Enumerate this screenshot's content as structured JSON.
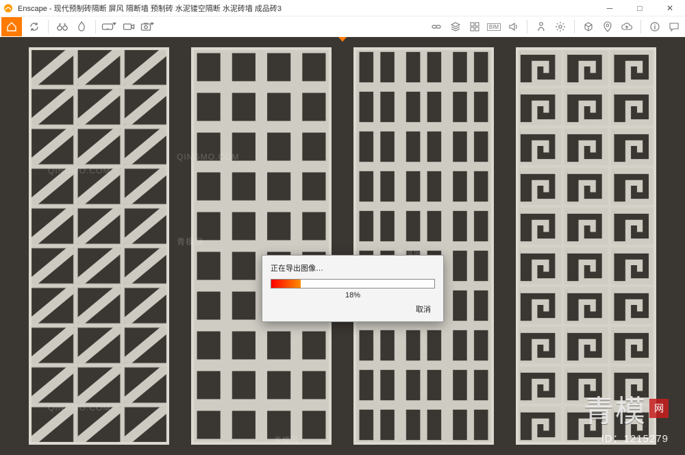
{
  "app_icon": "enscape-icon",
  "title": "Enscape - 现代预制砖隔断 屏风 隔断墙 预制砖 水泥镂空隔断 水泥砖墙 成品砖3",
  "bim_label": "BIM",
  "marker_caret": "▼",
  "dialog": {
    "title": "正在导出图像…",
    "percent_label": "18%",
    "percent_value": 18,
    "cancel": "取消"
  },
  "watermarks": {
    "small_1": "QINGMO.COM",
    "small_2": "青模网",
    "small_3": "QINGMO.COM",
    "brand_text": "青模",
    "brand_seal": "网",
    "id_label": "ID：1215279"
  }
}
